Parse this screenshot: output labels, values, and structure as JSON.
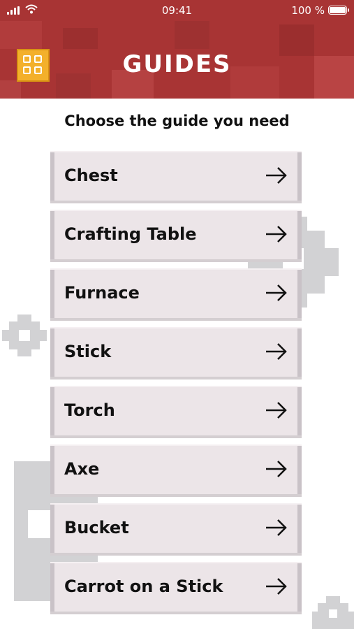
{
  "status_bar": {
    "time": "09:41",
    "battery_text": "100 %"
  },
  "header": {
    "title": "GUIDES",
    "menu_icon": "grid-icon"
  },
  "subtitle": "Choose the guide you need",
  "guides": [
    {
      "label": "Chest"
    },
    {
      "label": "Crafting Table"
    },
    {
      "label": "Furnace"
    },
    {
      "label": "Stick"
    },
    {
      "label": "Torch"
    },
    {
      "label": "Axe"
    },
    {
      "label": "Bucket"
    },
    {
      "label": "Carrot on a Stick"
    }
  ],
  "colors": {
    "header": "#a83434",
    "menu_button": "#f3b02b",
    "card": "#ece5e8"
  }
}
